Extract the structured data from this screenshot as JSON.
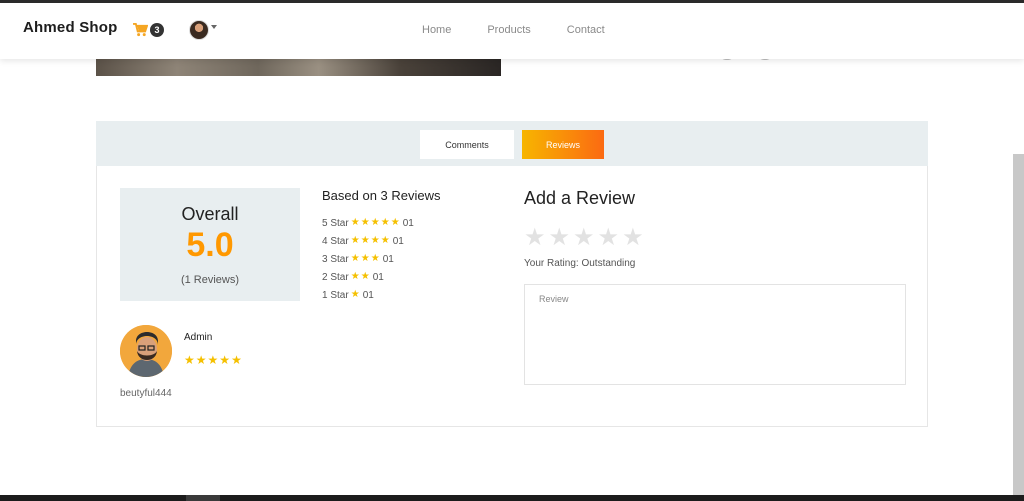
{
  "navbar": {
    "brand": "Ahmed Shop",
    "cart_count": "3",
    "links": [
      "Home",
      "Products",
      "Contact"
    ]
  },
  "tabs": {
    "comments_label": "Comments",
    "reviews_label": "Reviews",
    "active": "Reviews"
  },
  "summary": {
    "overall_label": "Overall",
    "score": "5.0",
    "count_text": "(1 Reviews)",
    "based_title": "Based on 3 Reviews",
    "distribution": [
      {
        "label": "5 Star",
        "stars": 5,
        "count": "01"
      },
      {
        "label": "4 Star",
        "stars": 4,
        "count": "01"
      },
      {
        "label": "3 Star",
        "stars": 3,
        "count": "01"
      },
      {
        "label": "2 Star",
        "stars": 2,
        "count": "01"
      },
      {
        "label": "1 Star",
        "stars": 1,
        "count": "01"
      }
    ]
  },
  "review": {
    "author": "Admin",
    "stars": 5,
    "text": "beutyful444"
  },
  "add_review": {
    "title": "Add a Review",
    "rating_text": "Your Rating: Outstanding",
    "placeholder": "Review"
  },
  "colors": {
    "accent": "#ff9800",
    "star": "#f5c000",
    "panel_bg": "#e8eef0"
  }
}
